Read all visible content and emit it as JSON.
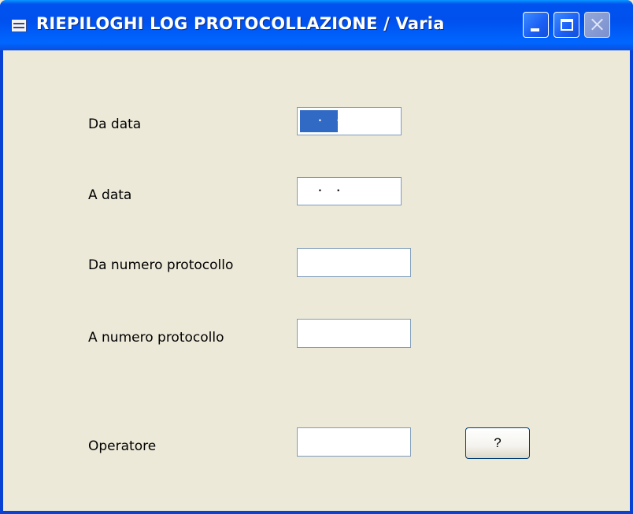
{
  "window": {
    "title": "RIEPILOGHI LOG PROTOCOLLAZIONE / Varia"
  },
  "title_buttons": {
    "minimize": "minimize-icon",
    "maximize": "maximize-icon",
    "close": "close-icon"
  },
  "form": {
    "da_data": {
      "label": "Da data",
      "value": " . ."
    },
    "a_data": {
      "label": "A data",
      "value": " . ."
    },
    "da_numero": {
      "label": "Da numero protocollo",
      "value": ""
    },
    "a_numero": {
      "label": "A numero protocollo",
      "value": ""
    },
    "operatore": {
      "label": "Operatore",
      "value": "",
      "lookup_button_label": "?"
    }
  },
  "colors": {
    "titlebar": "#0054e3",
    "window_bg": "#ece9d8",
    "selection": "#316ac5",
    "field_border": "#7f9db9"
  }
}
